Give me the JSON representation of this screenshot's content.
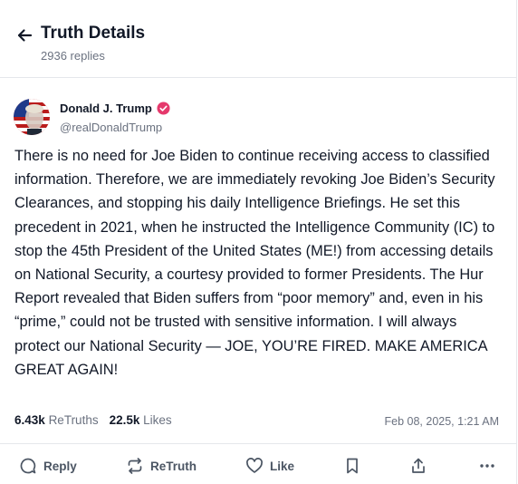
{
  "header": {
    "title": "Truth Details",
    "replies_count": "2936 replies"
  },
  "author": {
    "name": "Donald J. Trump",
    "handle": "@realDonaldTrump"
  },
  "post": {
    "text": "There is no need for Joe Biden to continue receiving access to classified information. Therefore, we are immediately revoking Joe Biden’s Security Clearances, and stopping his daily Intelligence Briefings. He set this precedent in 2021, when he instructed the Intelligence Community (IC) to stop the 45th President of the United States (ME!) from accessing details on National Security, a courtesy provided to former Presidents. The Hur Report revealed that Biden suffers from “poor memory” and, even in his “prime,” could not be trusted with sensitive information. I will always protect our National Security — JOE, YOU’RE FIRED. MAKE AMERICA GREAT AGAIN!",
    "retruths_count": "6.43k",
    "retruths_label": "ReTruths",
    "likes_count": "22.5k",
    "likes_label": "Likes",
    "timestamp": "Feb 08, 2025, 1:21 AM"
  },
  "actions": {
    "reply_label": "Reply",
    "retruth_label": "ReTruth",
    "like_label": "Like"
  },
  "colors": {
    "verified_badge": "#e5396c",
    "text_primary": "#111827",
    "text_secondary": "#6b7280",
    "divider": "#e5e7eb"
  },
  "icons": [
    "back-arrow-icon",
    "verified-badge-icon",
    "reply-icon",
    "retruth-icon",
    "like-icon",
    "bookmark-icon",
    "share-icon",
    "more-icon"
  ]
}
